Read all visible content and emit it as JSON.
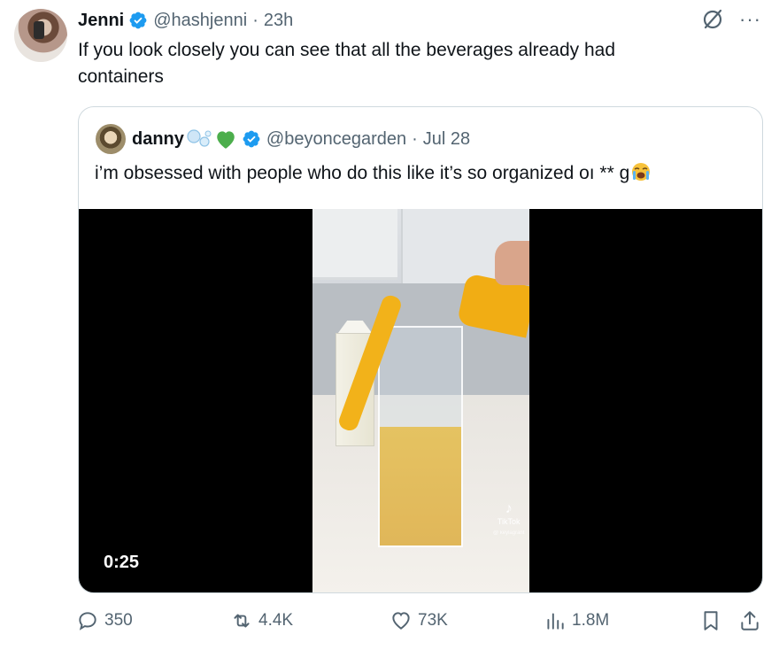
{
  "tweet": {
    "author_name": "Jenni",
    "handle": "@hashjenni",
    "separator": "·",
    "time": "23h",
    "text": "If you look closely you can see that all the beverages already had containers",
    "more": "···"
  },
  "quote": {
    "author_name": "danny",
    "handle": "@beyoncegarden",
    "separator": "·",
    "date": "Jul 28",
    "text": "i’m obsessed with people who do this like it’s so organized oı ** g",
    "video": {
      "duration": "0:25",
      "watermark": "TikTok",
      "watermark_user": "@ keylagrant"
    }
  },
  "actions": {
    "replies": "350",
    "reposts": "4.4K",
    "likes": "73K",
    "views": "1.8M"
  },
  "colors": {
    "verified": "#1d9bf0",
    "text_secondary": "#536471",
    "border": "#cfd9de",
    "heart_green": "#4cae4c"
  }
}
